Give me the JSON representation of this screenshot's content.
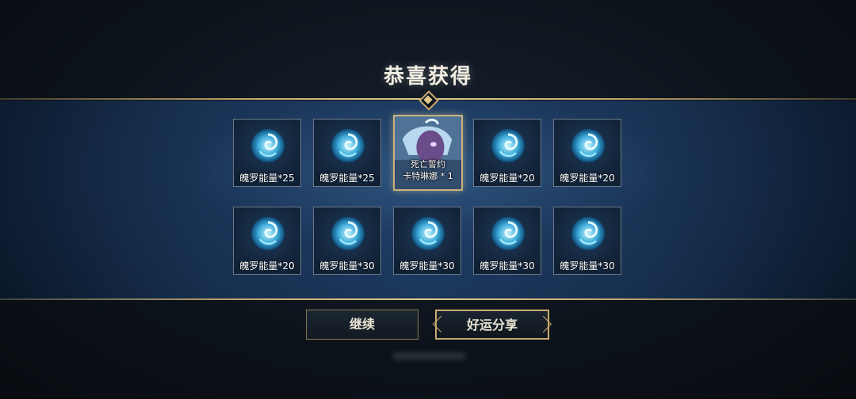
{
  "title": "恭喜获得",
  "rewards_row1": [
    {
      "label": "魄罗能量*25"
    },
    {
      "label": "魄罗能量*25"
    },
    {
      "special": true,
      "line1": "死亡誓约",
      "line2": "卡特琳娜 * 1"
    },
    {
      "label": "魄罗能量*20"
    },
    {
      "label": "魄罗能量*20"
    }
  ],
  "rewards_row2": [
    {
      "label": "魄罗能量*20"
    },
    {
      "label": "魄罗能量*30"
    },
    {
      "label": "魄罗能量*30"
    },
    {
      "label": "魄罗能量*30"
    },
    {
      "label": "魄罗能量*30"
    }
  ],
  "buttons": {
    "continue": "继续",
    "share": "好运分享"
  },
  "icons": {
    "reward": "poro-energy-swirl-icon",
    "special": "skin-portrait"
  }
}
